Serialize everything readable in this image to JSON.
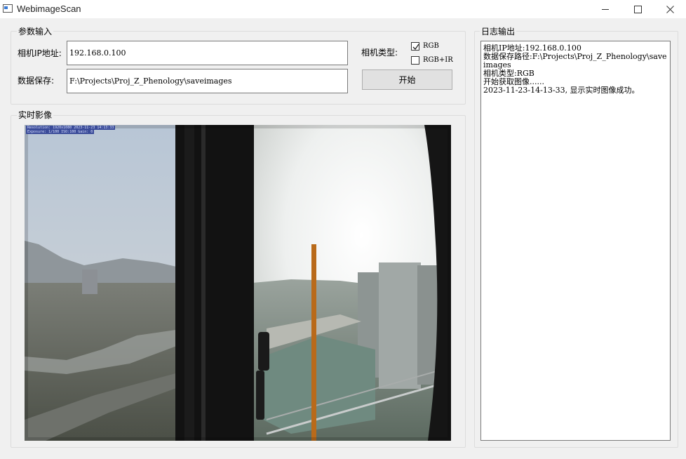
{
  "window": {
    "title": "WebimageScan",
    "controls": [
      "minimize-icon",
      "maximize-icon",
      "close-icon"
    ]
  },
  "params_group": {
    "title": "参数输入",
    "camera_ip_label": "相机IP地址:",
    "camera_ip_value": "192.168.0.100",
    "save_path_label": "数据保存:",
    "save_path_value": "F:\\Projects\\Proj_Z_Phenology\\saveimages",
    "camera_type_label": "相机类型:",
    "options": [
      {
        "label": "RGB",
        "checked": true
      },
      {
        "label": "RGB+IR",
        "checked": false
      }
    ],
    "start_button": "开始"
  },
  "live_group": {
    "title": "实时影像",
    "image_overlay": [
      "Resolution: 1920x1080  2023-11-23 14:13:33",
      "Exposure: 1/100  ISO:100  Gain: 0"
    ]
  },
  "log_group": {
    "title": "日志输出",
    "lines": [
      "相机IP地址:192.168.0.100",
      "数据保存路径:F:\\Projects\\Proj_Z_Phenology\\saveimages",
      "相机类型:RGB",
      "开始获取图像......",
      "2023-11-23-14-13-33, 显示实时图像成功。"
    ]
  },
  "colors": {
    "window_bg": "#f0f0f0",
    "titlebar_bg": "#ffffff",
    "button_bg": "#e1e1e1",
    "field_border": "#7a7a7a"
  }
}
